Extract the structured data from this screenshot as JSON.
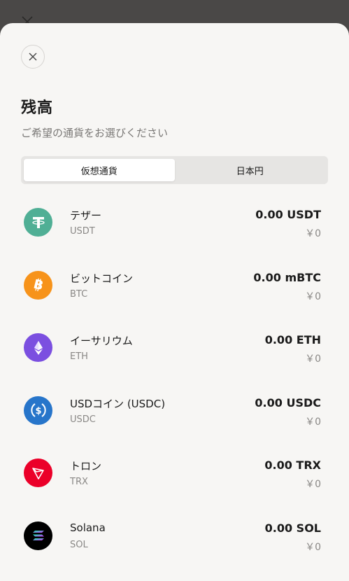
{
  "title": "残高",
  "subtitle": "ご希望の通貨をお選びください",
  "tabs": [
    {
      "label": "仮想通貨",
      "active": true
    },
    {
      "label": "日本円",
      "active": false
    }
  ],
  "coins": [
    {
      "name": "テザー",
      "symbol": "USDT",
      "amount": "0.00 USDT",
      "fiat": "￥0",
      "icon": "tether-icon",
      "color": "#50af95"
    },
    {
      "name": "ビットコイン",
      "symbol": "BTC",
      "amount": "0.00 mBTC",
      "fiat": "￥0",
      "icon": "bitcoin-icon",
      "color": "#f7931a"
    },
    {
      "name": "イーサリウム",
      "symbol": "ETH",
      "amount": "0.00 ETH",
      "fiat": "￥0",
      "icon": "ethereum-icon",
      "color": "#7b4fe0"
    },
    {
      "name": "USDコイン (USDC)",
      "symbol": "USDC",
      "amount": "0.00 USDC",
      "fiat": "￥0",
      "icon": "usdc-icon",
      "color": "#2775ca"
    },
    {
      "name": "トロン",
      "symbol": "TRX",
      "amount": "0.00 TRX",
      "fiat": "￥0",
      "icon": "tron-icon",
      "color": "#eb0029"
    },
    {
      "name": "Solana",
      "symbol": "SOL",
      "amount": "0.00 SOL",
      "fiat": "￥0",
      "icon": "solana-icon",
      "color": "#000000"
    }
  ]
}
